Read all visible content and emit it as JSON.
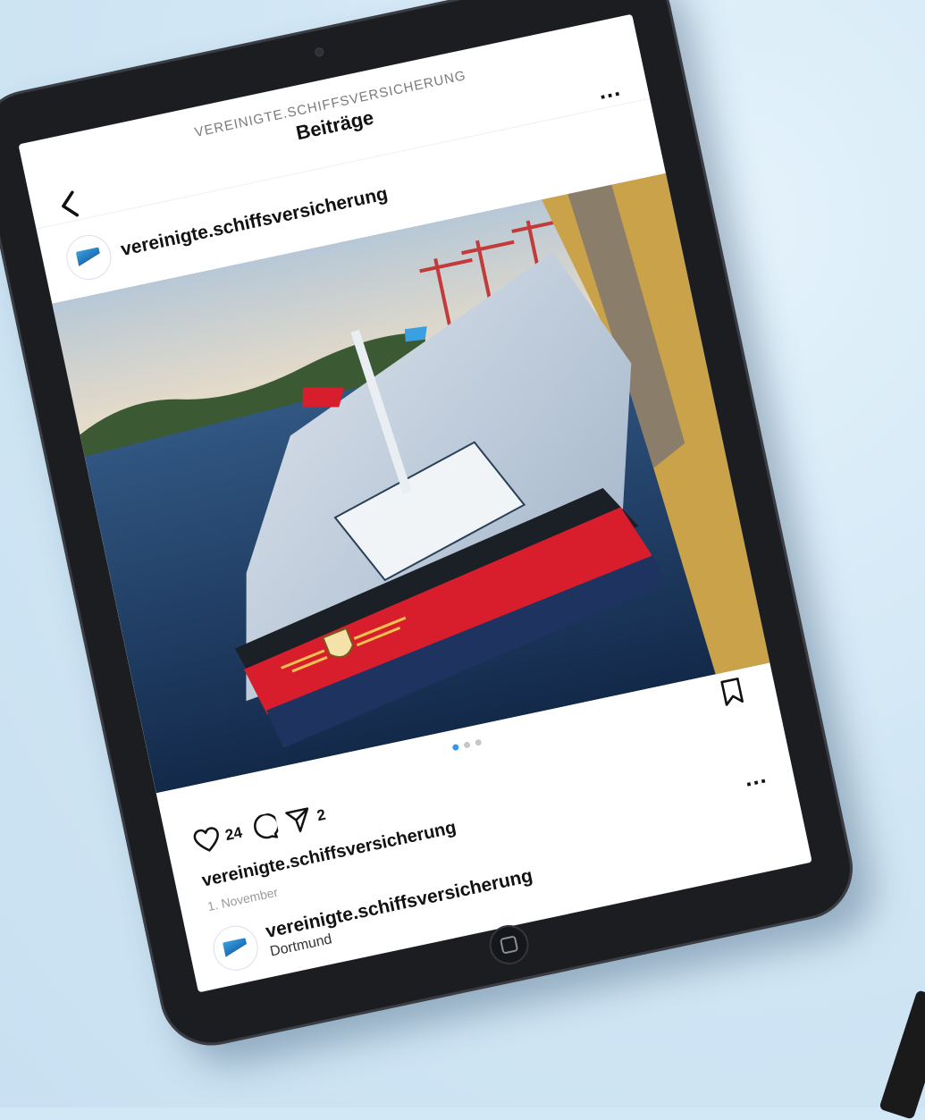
{
  "header": {
    "account": "VEREINIGTE.SCHIFFSVERSICHERUNG",
    "title": "Beiträge"
  },
  "post": {
    "username": "vereinigte.schiffsversicherung",
    "likes": "24",
    "shares": "2",
    "caption_user": "vereinigte.schiffsversicherung",
    "date": "1. November",
    "carousel": {
      "total": 3,
      "active": 1
    }
  },
  "post2": {
    "username": "vereinigte.schiffsversicherung",
    "location": "Dortmund"
  },
  "icons": [
    "back-icon",
    "more-icon",
    "heart-icon",
    "comment-icon",
    "share-icon",
    "bookmark-icon",
    "home-button-icon"
  ],
  "colors": {
    "accent_blue": "#3897f0",
    "background": "#d3e8f6",
    "tablet": "#1b1d21"
  }
}
